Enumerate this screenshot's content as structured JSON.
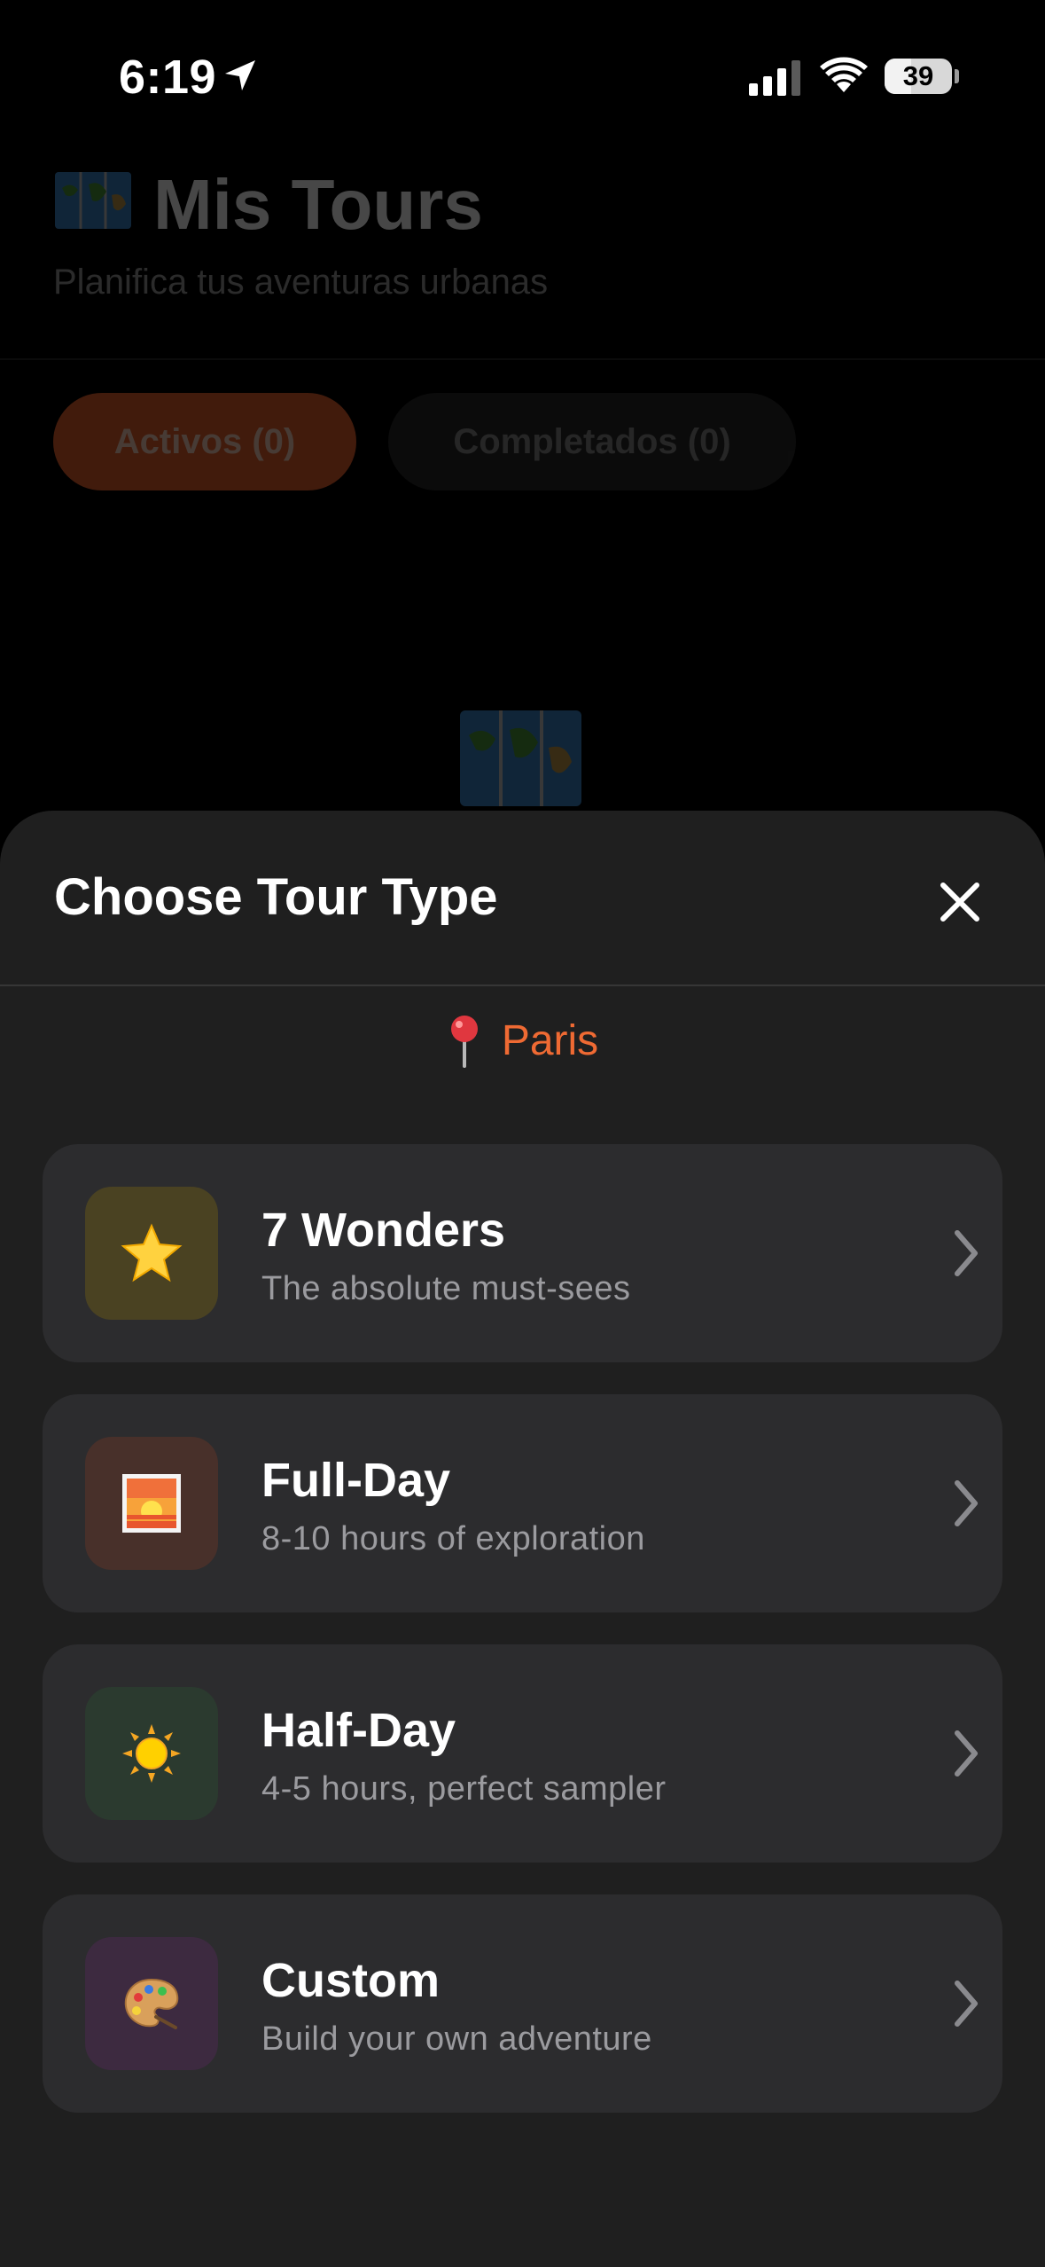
{
  "status_bar": {
    "time": "6:19",
    "battery_percent": "39",
    "battery_level": 0.39
  },
  "background": {
    "title": "Mis Tours",
    "title_emoji_icon": "map-icon",
    "subtitle": "Planifica tus aventuras urbanas",
    "tabs": [
      {
        "label": "Activos (0)",
        "active": true
      },
      {
        "label": "Completados (0)",
        "active": false
      }
    ],
    "empty_state_icon": "map-icon"
  },
  "sheet": {
    "title": "Choose Tour Type",
    "close_icon": "close-icon",
    "location": {
      "icon": "pin-icon",
      "name": "Paris"
    },
    "options": [
      {
        "title": "7 Wonders",
        "subtitle": "The absolute must-sees",
        "icon": "star-icon",
        "icon_bg": "#4a4222"
      },
      {
        "title": "Full-Day",
        "subtitle": "8-10 hours of exploration",
        "icon": "sunrise-picture-icon",
        "icon_bg": "#48302a"
      },
      {
        "title": "Half-Day",
        "subtitle": "4-5 hours, perfect sampler",
        "icon": "sun-icon",
        "icon_bg": "#2b3a2f"
      },
      {
        "title": "Custom",
        "subtitle": "Build your own adventure",
        "icon": "palette-icon",
        "icon_bg": "#3d2a40"
      }
    ]
  },
  "colors": {
    "accent": "#ef6a33",
    "sheet_bg": "#1f1f1f",
    "card_bg": "#2c2c2e"
  }
}
